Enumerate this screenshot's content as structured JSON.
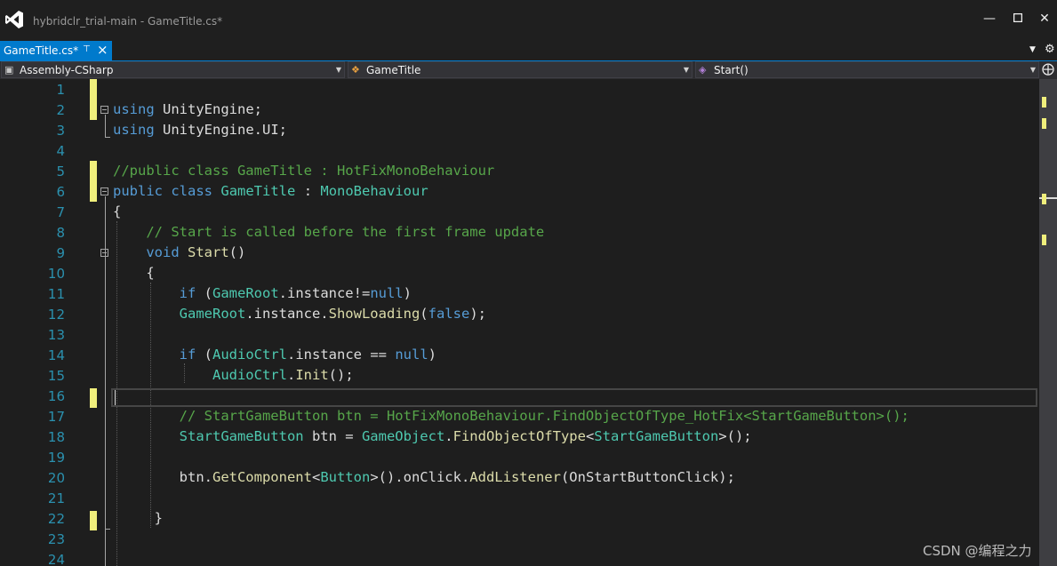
{
  "window": {
    "title": "hybridclr_trial-main - GameTitle.cs*",
    "minimize_icon": "minimize-icon",
    "maximize_icon": "maximize-icon",
    "close_icon": "close-icon"
  },
  "tab": {
    "label": "GameTitle.cs*",
    "accent_color": "#007acc"
  },
  "navbar": {
    "project": "Assembly-CSharp",
    "type": "GameTitle",
    "member": "Start()"
  },
  "editor": {
    "current_line": 16,
    "lines": [
      {
        "n": "1",
        "code": ""
      },
      {
        "n": "2",
        "code": "using UnityEngine;"
      },
      {
        "n": "3",
        "code": "using UnityEngine.UI;"
      },
      {
        "n": "4",
        "code": ""
      },
      {
        "n": "5",
        "code": "//public class GameTitle : HotFixMonoBehaviour"
      },
      {
        "n": "6",
        "code": "public class GameTitle : MonoBehaviour"
      },
      {
        "n": "7",
        "code": "{"
      },
      {
        "n": "8",
        "code": "    // Start is called before the first frame update"
      },
      {
        "n": "9",
        "code": "    void Start()"
      },
      {
        "n": "10",
        "code": "    {"
      },
      {
        "n": "11",
        "code": "        if (GameRoot.instance!=null)"
      },
      {
        "n": "12",
        "code": "        GameRoot.instance.ShowLoading(false);"
      },
      {
        "n": "13",
        "code": ""
      },
      {
        "n": "14",
        "code": "        if (AudioCtrl.instance == null)"
      },
      {
        "n": "15",
        "code": "            AudioCtrl.Init();"
      },
      {
        "n": "16",
        "code": ""
      },
      {
        "n": "17",
        "code": "        // StartGameButton btn = HotFixMonoBehaviour.FindObjectOfType_HotFix<StartGameButton>();"
      },
      {
        "n": "18",
        "code": "        StartGameButton btn = GameObject.FindObjectOfType<StartGameButton>();"
      },
      {
        "n": "19",
        "code": ""
      },
      {
        "n": "20",
        "code": "        btn.GetComponent<Button>().onClick.AddListener(OnStartButtonClick);"
      },
      {
        "n": "21",
        "code": ""
      },
      {
        "n": "22",
        "code": "     }"
      },
      {
        "n": "23",
        "code": ""
      },
      {
        "n": "24",
        "code": ""
      }
    ]
  },
  "watermark": "CSDN @编程之力",
  "colors": {
    "keyword": "#569cd6",
    "type": "#4ec9b0",
    "method": "#dcdcaa",
    "comment": "#57a64a",
    "line_number": "#2b91af",
    "change_marker": "#f0ef7c"
  }
}
